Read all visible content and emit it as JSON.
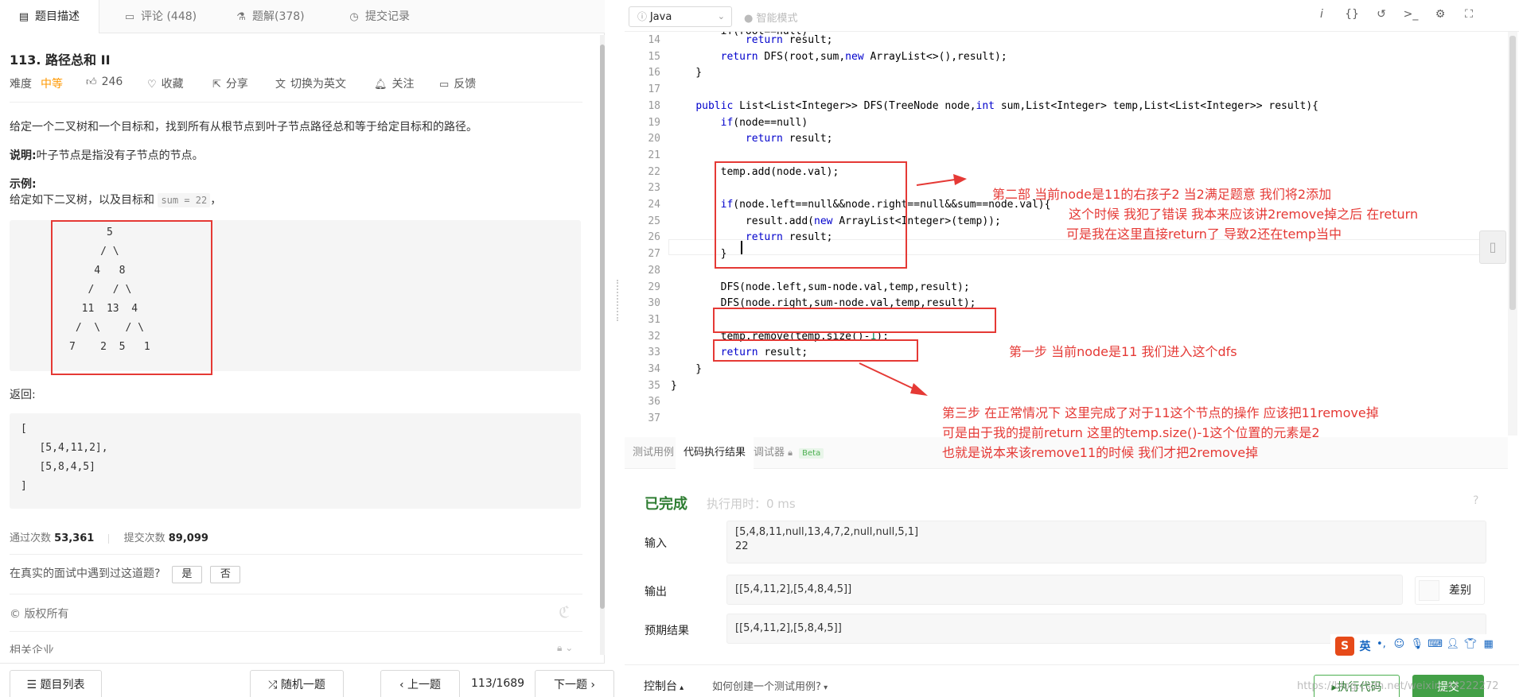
{
  "left_tabs": [
    {
      "icon": "document-icon",
      "label": "题目描述"
    },
    {
      "icon": "comment-icon",
      "label": "评论 (448)"
    },
    {
      "icon": "flask-icon",
      "label": "题解(378)"
    },
    {
      "icon": "clock-icon",
      "label": "提交记录"
    }
  ],
  "problem": {
    "title": "113. 路径总和 II",
    "difficulty_label": "难度",
    "difficulty": "中等",
    "likes": "246",
    "favorite": "收藏",
    "share": "分享",
    "switch_lang": "切换为英文",
    "follow": "关注",
    "feedback": "反馈",
    "description": "给定一个二叉树和一个目标和，找到所有从根节点到叶子节点路径总和等于给定目标和的路径。",
    "note_label": "说明:",
    "note_text": "叶子节点是指没有子节点的节点。",
    "example_label": "示例:",
    "example_text": "给定如下二叉树，以及目标和",
    "example_code": "sum = 22",
    "example_comma": "，",
    "tree": [
      "      5",
      "     / \\",
      "    4   8",
      "   /   / \\",
      "  11  13  4",
      " /  \\    / \\",
      "7    2  5   1"
    ],
    "return_label": "返回:",
    "return_lines": [
      "[",
      "   [5,4,11,2],",
      "   [5,8,4,5]",
      "]"
    ]
  },
  "stats": {
    "accepted_label": "通过次数",
    "accepted": "53,361",
    "submitted_label": "提交次数",
    "submitted": "89,099"
  },
  "interview": {
    "question": "在真实的面试中遇到过这道题?",
    "yes": "是",
    "no": "否"
  },
  "copyright": "© 版权所有",
  "companies": "相关企业",
  "left_bottom": {
    "list": "题目列表",
    "random": "随机一题",
    "prev": "上一题",
    "counter": "113/1689",
    "next": "下一题"
  },
  "toolbar": {
    "language": "Java",
    "smart_mode": "智能模式"
  },
  "code": [
    {
      "n": "14",
      "t": "            return result;"
    },
    {
      "n": "15",
      "t": "        return DFS(root,sum,new ArrayList<>(),result);"
    },
    {
      "n": "16",
      "t": "    }"
    },
    {
      "n": "17",
      "t": ""
    },
    {
      "n": "18",
      "t": "    public List<List<Integer>> DFS(TreeNode node,int sum,List<Integer> temp,List<List<Integer>> result){"
    },
    {
      "n": "19",
      "t": "        if(node==null)"
    },
    {
      "n": "20",
      "t": "            return result;"
    },
    {
      "n": "21",
      "t": ""
    },
    {
      "n": "22",
      "t": "        temp.add(node.val);"
    },
    {
      "n": "23",
      "t": ""
    },
    {
      "n": "24",
      "t": "        if(node.left==null&&node.right==null&&sum==node.val){"
    },
    {
      "n": "25",
      "t": "            result.add(new ArrayList<Integer>(temp));"
    },
    {
      "n": "26",
      "t": "            return result;"
    },
    {
      "n": "27",
      "t": "        }"
    },
    {
      "n": "28",
      "t": ""
    },
    {
      "n": "29",
      "t": "        DFS(node.left,sum-node.val,temp,result);"
    },
    {
      "n": "30",
      "t": "        DFS(node.right,sum-node.val,temp,result);"
    },
    {
      "n": "31",
      "t": ""
    },
    {
      "n": "32",
      "t": "        temp.remove(temp.size()-1);"
    },
    {
      "n": "33",
      "t": "        return result;"
    },
    {
      "n": "34",
      "t": "    }"
    },
    {
      "n": "35",
      "t": "}"
    },
    {
      "n": "36",
      "t": ""
    },
    {
      "n": "37",
      "t": ""
    }
  ],
  "annotations": {
    "step2": [
      "第二部 当前node是11的右孩子2  当2满足题意 我们将2添加",
      "这个时候 我犯了错误 我本来应该讲2remove掉之后 在return",
      "可是我在这里直接return了 导致2还在temp当中"
    ],
    "step1": "第一步 当前node是11 我们进入这个dfs",
    "step3": [
      "第三步  在正常情况下 这里完成了对于11这个节点的操作 应该把11remove掉",
      "可是由于我的提前return 这里的temp.size()-1这个位置的元素是2",
      "也就是说本来该remove11的时候 我们才把2remove掉"
    ]
  },
  "console_tabs": {
    "testcase": "测试用例",
    "result": "代码执行结果",
    "debugger": "调试器",
    "beta": "Beta"
  },
  "result": {
    "status": "已完成",
    "runtime": "执行用时：0 ms",
    "input_label": "输入",
    "input_lines": [
      "[5,4,8,11,null,13,4,7,2,null,null,5,1]",
      "22"
    ],
    "output_label": "输出",
    "output": "[[5,4,11,2],[5,4,8,4,5]]",
    "diff": "差别",
    "expected_label": "预期结果",
    "expected": "[[5,4,11,2],[5,8,4,5]]"
  },
  "right_bottom": {
    "console": "控制台",
    "howto": "如何创建一个测试用例?",
    "run": "执行代码",
    "submit": "提交",
    "watermark": "https://blog.csdn.net/weixin_44222272"
  },
  "ime": {
    "logo": "S",
    "lang": "英"
  },
  "colors": {
    "accent_red": "#e53935",
    "done_green": "#2e7d32",
    "submit_green": "#43a047",
    "difficulty_orange": "#ff9800"
  }
}
